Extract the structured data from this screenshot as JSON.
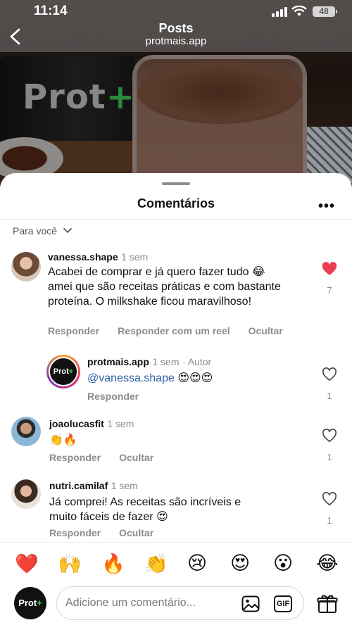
{
  "status": {
    "time": "11:14",
    "battery": "48"
  },
  "header": {
    "title": "Posts",
    "subtitle": "protmais.app"
  },
  "photo": {
    "brand_text": "Prot",
    "brand_plus": "+"
  },
  "sheet": {
    "title": "Comentários",
    "more": "•••",
    "filter": "Para você"
  },
  "comments": [
    {
      "username": "vanessa.shape",
      "time": "1 sem",
      "text": "Acabei de comprar e já quero fazer tudo 😂 amei que são receitas práticas e com bastante proteína. O milkshake ficou maravilhoso!",
      "actions": [
        "Responder",
        "Responder com um reel",
        "Ocultar"
      ],
      "likes": "7",
      "liked": true
    },
    {
      "username": "protmais.app",
      "time": "1 sem",
      "author_label": "· Autor",
      "mention": "@vanessa.shape",
      "text": " 😍😍😍",
      "actions": [
        "Responder"
      ],
      "likes": "1",
      "liked": false,
      "avatar_text": "Prot",
      "avatar_plus": "+"
    },
    {
      "username": "joaolucasfit",
      "time": "1 sem",
      "text": "👏🔥",
      "actions": [
        "Responder",
        "Ocultar"
      ],
      "likes": "1",
      "liked": false
    },
    {
      "username": "nutri.camilaf",
      "time": "1 sem",
      "text": "Já comprei! As receitas são incríveis e muito fáceis de fazer 😍",
      "actions": [
        "Responder",
        "Ocultar"
      ],
      "likes": "1",
      "liked": false
    }
  ],
  "reactions": [
    "❤️",
    "🙌",
    "🔥",
    "👏",
    "😢",
    "😍",
    "😮",
    "😂"
  ],
  "composer": {
    "placeholder": "Adicione um comentário...",
    "avatar_text": "Prot",
    "avatar_plus": "+",
    "gif_label": "GIF"
  }
}
